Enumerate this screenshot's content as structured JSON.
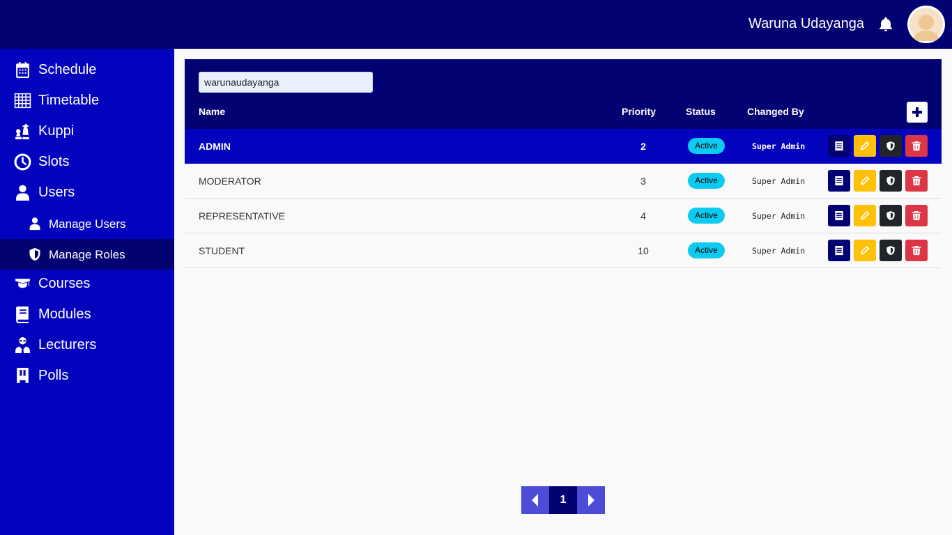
{
  "header": {
    "user_name": "Waruna Udayanga",
    "icons": [
      "bell-icon",
      "avatar"
    ]
  },
  "sidebar": {
    "items": [
      {
        "label": "Schedule",
        "icon": "calendar-icon"
      },
      {
        "label": "Timetable",
        "icon": "grid-icon"
      },
      {
        "label": "Kuppi",
        "icon": "chess-icon"
      },
      {
        "label": "Slots",
        "icon": "clock-icon"
      },
      {
        "label": "Users",
        "icon": "user-icon"
      },
      {
        "label": "Manage Users",
        "icon": "user-icon",
        "sub": true
      },
      {
        "label": "Manage Roles",
        "icon": "shield-icon",
        "sub": true,
        "active": true
      },
      {
        "label": "Courses",
        "icon": "graduation-cap-icon"
      },
      {
        "label": "Modules",
        "icon": "book-icon"
      },
      {
        "label": "Lecturers",
        "icon": "lecturer-icon"
      },
      {
        "label": "Polls",
        "icon": "poll-icon"
      }
    ]
  },
  "roles": {
    "search_value": "warunaudayanga",
    "headers": {
      "name": "Name",
      "priority": "Priority",
      "status": "Status",
      "changed_by": "Changed By"
    },
    "rows": [
      {
        "name": "ADMIN",
        "priority": "2",
        "status": "Active",
        "changed_by": "Super Admin",
        "selected": true
      },
      {
        "name": "MODERATOR",
        "priority": "3",
        "status": "Active",
        "changed_by": "Super Admin"
      },
      {
        "name": "REPRESENTATIVE",
        "priority": "4",
        "status": "Active",
        "changed_by": "Super Admin"
      },
      {
        "name": "STUDENT",
        "priority": "10",
        "status": "Active",
        "changed_by": "Super Admin"
      }
    ],
    "row_actions": [
      "view-icon",
      "edit-icon",
      "shield-icon",
      "trash-icon"
    ]
  },
  "pagination": {
    "current_page": "1"
  },
  "colors": {
    "topbar": "#020272",
    "sidebar": "#0303bd",
    "selected_row": "#0303bd",
    "status_badge": "#0dcaf0",
    "edit": "#ffc107",
    "delete": "#dc3545"
  }
}
